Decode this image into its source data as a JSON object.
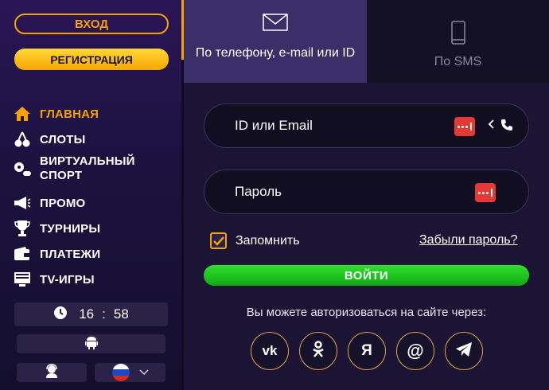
{
  "sidebar": {
    "login_label": "ВХОД",
    "register_label": "РЕГИСТРАЦИЯ",
    "nav": [
      {
        "label": "ГЛАВНАЯ",
        "icon": "home-icon",
        "active": true
      },
      {
        "label": "СЛОТЫ",
        "icon": "cherries-icon"
      },
      {
        "label_line1": "ВИРТУАЛЬНЫЙ",
        "label_line2": "СПОРТ",
        "icon": "virtual-sport-icon"
      },
      {
        "label": "ПРОМО",
        "icon": "megaphone-icon"
      },
      {
        "label": "ТУРНИРЫ",
        "icon": "trophy-icon"
      },
      {
        "label": "ПЛАТЕЖИ",
        "icon": "wallet-icon"
      },
      {
        "label": "TV-ИГРЫ",
        "icon": "tv-icon"
      }
    ],
    "time": {
      "hours": "16",
      "separator": ":",
      "minutes": "58"
    },
    "accent_color": "#f5a300"
  },
  "tabs": [
    {
      "label": "По телефону, e-mail или ID",
      "icon": "envelope-icon",
      "active": true
    },
    {
      "label": "По SMS",
      "icon": "smartphone-icon",
      "active": false
    }
  ],
  "form": {
    "id_placeholder": "ID или Email",
    "password_placeholder": "Пароль",
    "remember_label": "Запомнить",
    "remember_checked": true,
    "forgot_label": "Забыли пароль?",
    "submit_label": "ВОЙТИ",
    "social_text": "Вы можете авторизоваться на сайте через:",
    "social": [
      {
        "name": "vk",
        "icon": "vk-icon",
        "glyph": "vk"
      },
      {
        "name": "odnoklassniki",
        "icon": "odnoklassniki-icon"
      },
      {
        "name": "yandex",
        "icon": "yandex-icon",
        "glyph": "Я"
      },
      {
        "name": "mail",
        "icon": "at-icon",
        "glyph": "@"
      },
      {
        "name": "telegram",
        "icon": "telegram-icon"
      }
    ]
  }
}
